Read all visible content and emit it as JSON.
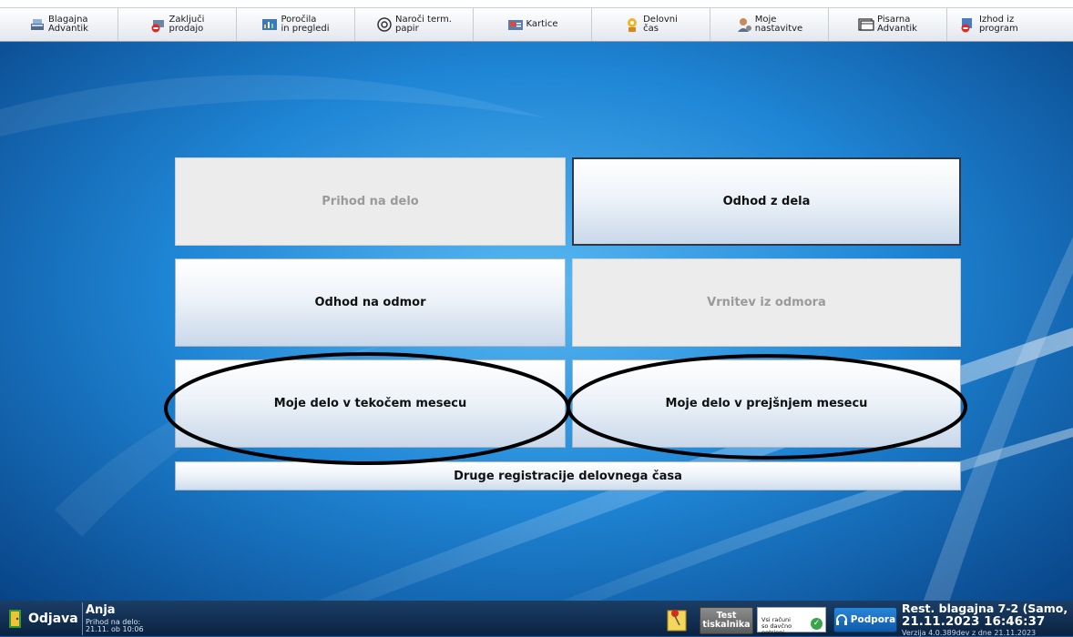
{
  "toolbar": {
    "items": [
      {
        "label": "Blagajna\nAdvantik",
        "icon": "cash-register-icon"
      },
      {
        "label": "Zaključi\nprodajo",
        "icon": "close-sale-icon"
      },
      {
        "label": "Poročila\nin pregledi",
        "icon": "reports-icon"
      },
      {
        "label": "Naroči term.\npapir",
        "icon": "paper-roll-icon"
      },
      {
        "label": "Kartice",
        "icon": "cards-icon"
      },
      {
        "label": "Delovni\nčas",
        "icon": "working-time-icon"
      },
      {
        "label": "Moje\nnastavitve",
        "icon": "user-settings-icon"
      },
      {
        "label": "Pisarna\nAdvantik",
        "icon": "office-icon"
      },
      {
        "label": "Izhod iz\nprogram",
        "icon": "exit-icon"
      }
    ]
  },
  "actions": {
    "arrival": {
      "label": "Prihod na delo",
      "state": "disabled"
    },
    "departure": {
      "label": "Odhod z dela",
      "state": "active"
    },
    "break_start": {
      "label": "Odhod na odmor",
      "state": "active"
    },
    "break_end": {
      "label": "Vrnitev iz odmora",
      "state": "disabled"
    },
    "current_month": {
      "label": "Moje delo v tekočem mesecu",
      "state": "active"
    },
    "previous_month": {
      "label": "Moje delo v prejšnjem mesecu",
      "state": "active"
    },
    "other": {
      "label": "Druge registracije delovnega časa"
    }
  },
  "statusbar": {
    "logout_label": "Odjava",
    "user_name": "Anja",
    "arrival_line1": "Prihod na delo:",
    "arrival_line2": "21.11. ob 10:06",
    "test_printer_label": "Test\ntiskalnika",
    "receipts_label": "Vsi računi\nso davčno\npotrjeni",
    "support_label": "Podpora",
    "station": "Rest. blagajna 7-2 (Samo,",
    "datetime": "21.11.2023 16:46:37",
    "version": "Verzija 4.0.389dev z dne 21.11.2023"
  },
  "colors": {
    "annotation_ellipse": "#000000",
    "background": "#0a5aa8",
    "status_ok": "#3aa44a",
    "support_button": "#1e6fc0"
  }
}
